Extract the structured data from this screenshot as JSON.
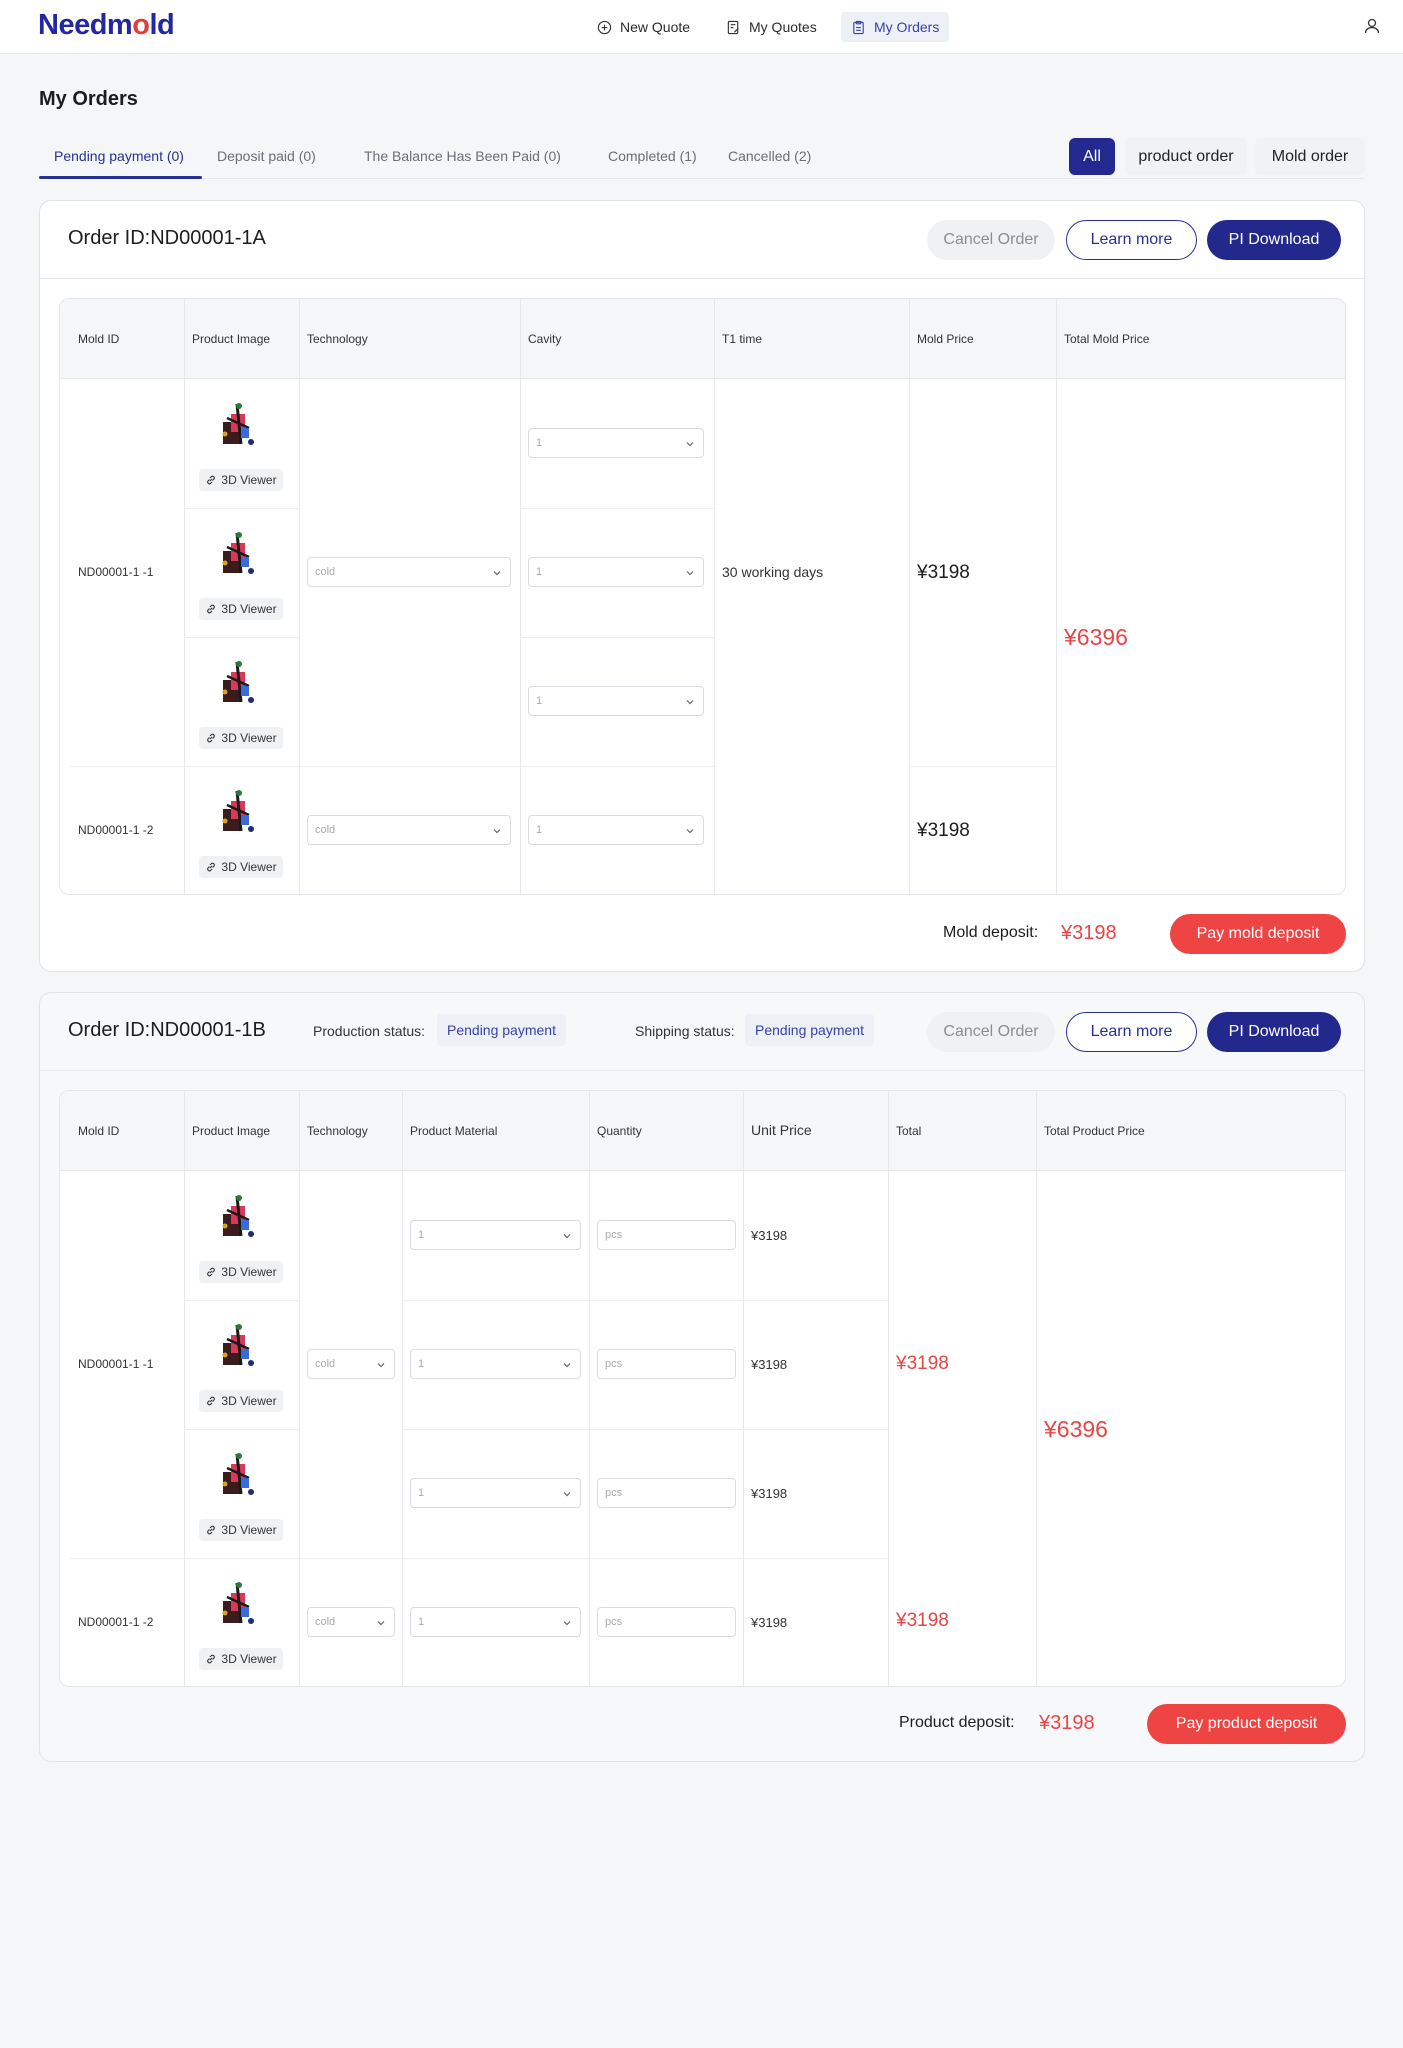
{
  "app": {
    "logo_left": "Need",
    "logo_m": "m",
    "logo_o": "o",
    "logo_right": "ld"
  },
  "nav": {
    "new_quote": "New Quote",
    "my_quotes": "My Quotes",
    "my_orders": "My Orders"
  },
  "page": {
    "title": "My Orders"
  },
  "tabs": [
    {
      "label": "Pending payment (0)"
    },
    {
      "label": "Deposit paid  (0)"
    },
    {
      "label": "The Balance Has Been Paid  (0)"
    },
    {
      "label": "Completed (1)"
    },
    {
      "label": "Cancelled (2)"
    }
  ],
  "filters": {
    "all": "All",
    "product": "product order",
    "mold": "Mold order"
  },
  "order1": {
    "id": "Order ID:ND00001-1A",
    "cancel": "Cancel Order",
    "learn": "Learn more",
    "pi": "PI Download",
    "headers": [
      "Mold ID",
      "Product Image",
      "Technology",
      "Cavity",
      "T1 time",
      "Mold Price",
      "Total Mold Price"
    ],
    "mold_ids": [
      "ND00001-1 -1",
      "ND00001-1 -2"
    ],
    "viewer": "3D Viewer",
    "technology": "cold",
    "cavity": "1",
    "t1_time": "30 working days",
    "mold_prices": [
      "¥3198",
      "¥3198"
    ],
    "total_mold_price": "¥6396",
    "deposit_label": "Mold deposit:",
    "deposit_value": "¥3198",
    "pay_label": "Pay mold deposit"
  },
  "order2": {
    "id": "Order ID:ND00001-1B",
    "production_label": "Production status:",
    "production_status": "Pending payment",
    "shipping_label": "Shipping status:",
    "shipping_status": "Pending payment",
    "cancel": "Cancel Order",
    "learn": "Learn more",
    "pi": "PI Download",
    "headers": [
      "Mold ID",
      "Product Image",
      "Technology",
      "Product Material",
      "Quantity",
      "Unit Price",
      "Total",
      "Total Product Price"
    ],
    "mold_ids": [
      "ND00001-1 -1",
      "ND00001-1 -2"
    ],
    "viewer": "3D Viewer",
    "technology": "cold",
    "material": "1",
    "quantity_placeholder": "pcs",
    "unit_price": "¥3198",
    "totals": [
      "¥3198",
      "¥3198"
    ],
    "total_product_price": "¥6396",
    "deposit_label": "Product deposit:",
    "deposit_value": "¥3198",
    "pay_label": "Pay product deposit"
  },
  "colors": {
    "brand": "#23289e",
    "accent_red": "#e84646",
    "pay_button": "#ef4444"
  }
}
